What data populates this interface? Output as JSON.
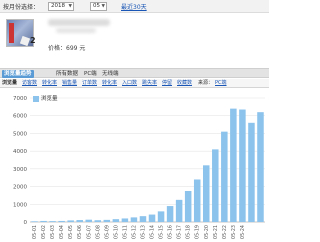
{
  "toolbar": {
    "month_label": "按月份选择：",
    "year": "2018",
    "month": "05",
    "recent_link": "最近30天"
  },
  "product": {
    "price": "价格：699 元",
    "thumb_number": "2"
  },
  "tabs": [
    {
      "label": "浏览量趋势",
      "active": true
    },
    {
      "label": "所有数据",
      "active": false
    },
    {
      "label": "PC端",
      "active": false
    },
    {
      "label": "无线端",
      "active": false
    }
  ],
  "metrics": [
    {
      "label": "浏览量",
      "style": "active"
    },
    {
      "label": "访客数",
      "style": "link"
    },
    {
      "label": "转化率",
      "style": "link"
    },
    {
      "label": "销售量",
      "style": "link"
    },
    {
      "label": "订单数",
      "style": "link"
    },
    {
      "label": "转化率",
      "style": "link"
    },
    {
      "label": "入口数",
      "style": "link"
    },
    {
      "label": "跳失率",
      "style": "link"
    },
    {
      "label": "停留",
      "style": "link"
    },
    {
      "label": "收藏数",
      "style": "link"
    },
    {
      "label": "来源：",
      "style": "plain"
    },
    {
      "label": "PC端",
      "style": "link"
    }
  ],
  "chart_data": {
    "type": "bar",
    "legend": [
      "浏览量"
    ],
    "ylim": [
      0,
      7000
    ],
    "yticks": [
      0,
      1000,
      2000,
      3000,
      4000,
      5000,
      6000,
      7000
    ],
    "grid": true,
    "bar_color": "#8cc3ec",
    "categories": [
      "05-01",
      "05-02",
      "05-03",
      "05-04",
      "05-05",
      "05-06",
      "05-07",
      "05-08",
      "05-09",
      "05-10",
      "05-11",
      "05-12",
      "05-13",
      "05-14",
      "05-15",
      "05-16",
      "05-17",
      "05-18",
      "05-19",
      "05-20",
      "05-21",
      "05-22",
      "05-23",
      "05-24",
      "05-25",
      "05-26"
    ],
    "tick_labels": [
      "05-01",
      "05-02",
      "05-03",
      "05-04",
      "05-05",
      "05-06",
      "05-07",
      "05-08",
      "05-09",
      "05-10",
      "05-11",
      "05-12",
      "05-13",
      "05-14",
      "05-15",
      "05-16",
      "05-17",
      "05-18",
      "05-19",
      "05-20",
      "05-21",
      "05-22",
      "05-23",
      "05-24",
      "",
      ""
    ],
    "values": [
      40,
      60,
      50,
      60,
      90,
      110,
      130,
      100,
      120,
      160,
      200,
      260,
      330,
      420,
      600,
      900,
      1250,
      1750,
      2400,
      3200,
      4100,
      5100,
      6400,
      6350,
      5600,
      6200
    ],
    "series": [
      {
        "name": "浏览量",
        "values": [
          40,
          60,
          50,
          60,
          90,
          110,
          130,
          100,
          120,
          160,
          200,
          260,
          330,
          420,
          600,
          900,
          1250,
          1750,
          2400,
          3200,
          4100,
          5100,
          6400,
          6350,
          5600,
          6200
        ]
      }
    ]
  }
}
